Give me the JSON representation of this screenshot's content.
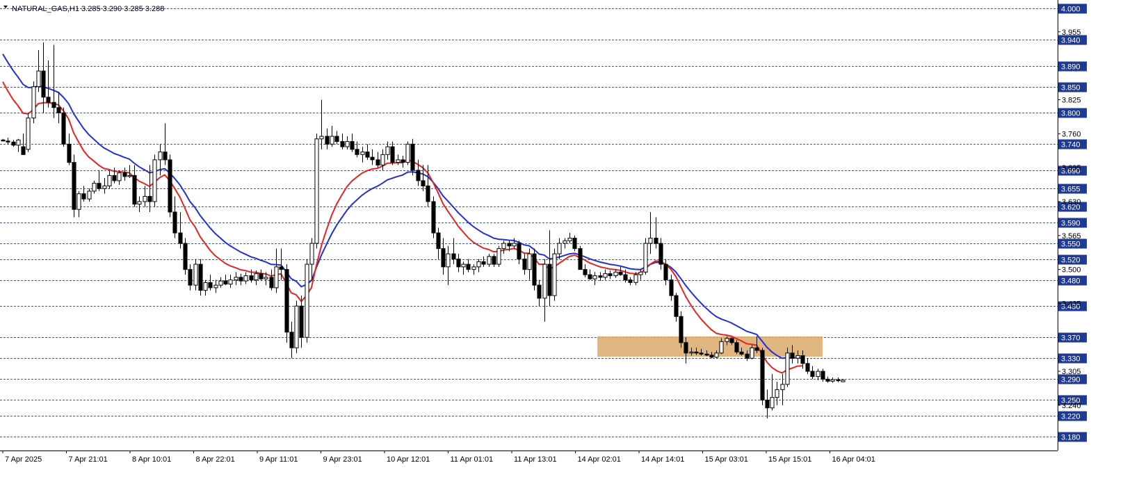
{
  "header": {
    "menu_icon": "triangle-down-icon",
    "symbol_line": "NATURAL_GAS,H1  3.285 3.290 3.285 3.288"
  },
  "colors": {
    "background": "#ffffff",
    "axis": "#000000",
    "bull_candle": "#ffffff",
    "bear_candle": "#000000",
    "level_line": "#1f3a93",
    "level_box": "#1f3a93",
    "ma_fast": "#e5231f",
    "ma_slow": "#1f2fdc",
    "zone_fill": "#d9a86a"
  },
  "chart_data": {
    "type": "candlestick",
    "symbol": "NATURAL_GAS",
    "timeframe": "H1",
    "last_ohlc": {
      "open": 3.285,
      "high": 3.29,
      "low": 3.285,
      "close": 3.288
    },
    "ylim": [
      3.16,
      4.0
    ],
    "price_scale_ticks": [
      "3.955",
      "3.825",
      "3.760",
      "3.695",
      "3.630",
      "3.565",
      "3.500",
      "3.435",
      "3.305",
      "3.240"
    ],
    "horizontal_levels": [
      "4.000",
      "3.940",
      "3.890",
      "3.850",
      "3.800",
      "3.740",
      "3.690",
      "3.655",
      "3.620",
      "3.590",
      "3.550",
      "3.520",
      "3.480",
      "3.430",
      "3.370",
      "3.330",
      "3.290",
      "3.250",
      "3.220",
      "3.180"
    ],
    "time_labels": [
      "7 Apr 2025",
      "7 Apr 21:01",
      "8 Apr 10:01",
      "8 Apr 22:01",
      "9 Apr 11:01",
      "9 Apr 23:01",
      "10 Apr 12:01",
      "11 Apr 01:01",
      "11 Apr 13:01",
      "14 Apr 02:01",
      "14 Apr 14:01",
      "15 Apr 03:01",
      "15 Apr 15:01",
      "16 Apr 04:01"
    ],
    "zone": {
      "price_high": 3.372,
      "price_low": 3.333,
      "start_index": 118,
      "end_index": 156
    },
    "ma_fast_label": "",
    "ma_slow_label": "",
    "candles": [
      [
        3.748,
        3.75,
        3.745,
        3.746
      ],
      [
        3.746,
        3.752,
        3.74,
        3.744
      ],
      [
        3.744,
        3.748,
        3.735,
        3.738
      ],
      [
        3.738,
        3.75,
        3.725,
        3.748
      ],
      [
        3.735,
        3.76,
        3.72,
        3.72
      ],
      [
        3.73,
        3.8,
        3.725,
        3.79
      ],
      [
        3.79,
        3.86,
        3.78,
        3.85
      ],
      [
        3.85,
        3.92,
        3.84,
        3.88
      ],
      [
        3.88,
        3.935,
        3.8,
        3.83
      ],
      [
        3.83,
        3.9,
        3.81,
        3.82
      ],
      [
        3.82,
        3.93,
        3.79,
        3.81
      ],
      [
        3.81,
        3.84,
        3.78,
        3.8
      ],
      [
        3.8,
        3.81,
        3.735,
        3.74
      ],
      [
        3.74,
        3.76,
        3.7,
        3.705
      ],
      [
        3.705,
        3.72,
        3.6,
        3.615
      ],
      [
        3.615,
        3.65,
        3.6,
        3.645
      ],
      [
        3.645,
        3.66,
        3.63,
        3.635
      ],
      [
        3.635,
        3.655,
        3.63,
        3.65
      ],
      [
        3.65,
        3.67,
        3.645,
        3.665
      ],
      [
        3.665,
        3.69,
        3.65,
        3.655
      ],
      [
        3.655,
        3.675,
        3.645,
        3.66
      ],
      [
        3.66,
        3.69,
        3.655,
        3.68
      ],
      [
        3.68,
        3.695,
        3.665,
        3.67
      ],
      [
        3.67,
        3.69,
        3.662,
        3.685
      ],
      [
        3.685,
        3.695,
        3.67,
        3.678
      ],
      [
        3.678,
        3.7,
        3.675,
        3.68
      ],
      [
        3.68,
        3.7,
        3.62,
        3.625
      ],
      [
        3.625,
        3.64,
        3.61,
        3.63
      ],
      [
        3.63,
        3.66,
        3.62,
        3.64
      ],
      [
        3.64,
        3.7,
        3.61,
        3.63
      ],
      [
        3.63,
        3.72,
        3.62,
        3.71
      ],
      [
        3.71,
        3.74,
        3.68,
        3.725
      ],
      [
        3.725,
        3.78,
        3.7,
        3.71
      ],
      [
        3.71,
        3.72,
        3.6,
        3.61
      ],
      [
        3.61,
        3.64,
        3.56,
        3.57
      ],
      [
        3.57,
        3.61,
        3.54,
        3.55
      ],
      [
        3.55,
        3.56,
        3.49,
        3.5
      ],
      [
        3.5,
        3.51,
        3.46,
        3.47
      ],
      [
        3.47,
        3.52,
        3.46,
        3.51
      ],
      [
        3.51,
        3.52,
        3.45,
        3.46
      ],
      [
        3.46,
        3.48,
        3.45,
        3.475
      ],
      [
        3.475,
        3.49,
        3.46,
        3.465
      ],
      [
        3.465,
        3.48,
        3.455,
        3.47
      ],
      [
        3.47,
        3.485,
        3.465,
        3.478
      ],
      [
        3.478,
        3.49,
        3.47,
        3.472
      ],
      [
        3.472,
        3.49,
        3.465,
        3.48
      ],
      [
        3.48,
        3.495,
        3.47,
        3.485
      ],
      [
        3.485,
        3.492,
        3.47,
        3.478
      ],
      [
        3.478,
        3.495,
        3.472,
        3.488
      ],
      [
        3.488,
        3.5,
        3.475,
        3.48
      ],
      [
        3.48,
        3.498,
        3.47,
        3.492
      ],
      [
        3.492,
        3.5,
        3.478,
        3.482
      ],
      [
        3.482,
        3.495,
        3.47,
        3.485
      ],
      [
        3.485,
        3.5,
        3.46,
        3.465
      ],
      [
        3.465,
        3.54,
        3.455,
        3.505
      ],
      [
        3.505,
        3.54,
        3.48,
        3.5
      ],
      [
        3.5,
        3.51,
        3.36,
        3.38
      ],
      [
        3.38,
        3.4,
        3.33,
        3.35
      ],
      [
        3.35,
        3.44,
        3.34,
        3.43
      ],
      [
        3.43,
        3.45,
        3.35,
        3.37
      ],
      [
        3.37,
        3.52,
        3.36,
        3.51
      ],
      [
        3.51,
        3.56,
        3.48,
        3.55
      ],
      [
        3.55,
        3.76,
        3.54,
        3.75
      ],
      [
        3.75,
        3.825,
        3.73,
        3.755
      ],
      [
        3.755,
        3.77,
        3.73,
        3.74
      ],
      [
        3.74,
        3.775,
        3.735,
        3.755
      ],
      [
        3.755,
        3.765,
        3.74,
        3.745
      ],
      [
        3.745,
        3.76,
        3.73,
        3.735
      ],
      [
        3.735,
        3.755,
        3.73,
        3.745
      ],
      [
        3.745,
        3.76,
        3.725,
        3.73
      ],
      [
        3.73,
        3.745,
        3.715,
        3.72
      ],
      [
        3.72,
        3.735,
        3.705,
        3.725
      ],
      [
        3.725,
        3.74,
        3.71,
        3.715
      ],
      [
        3.715,
        3.73,
        3.7,
        3.71
      ],
      [
        3.71,
        3.725,
        3.695,
        3.7
      ],
      [
        3.7,
        3.73,
        3.69,
        3.72
      ],
      [
        3.72,
        3.745,
        3.71,
        3.735
      ],
      [
        3.735,
        3.745,
        3.7,
        3.705
      ],
      [
        3.705,
        3.72,
        3.7,
        3.71
      ],
      [
        3.71,
        3.718,
        3.695,
        3.705
      ],
      [
        3.705,
        3.745,
        3.7,
        3.74
      ],
      [
        3.74,
        3.75,
        3.68,
        3.69
      ],
      [
        3.69,
        3.71,
        3.66,
        3.67
      ],
      [
        3.67,
        3.7,
        3.65,
        3.66
      ],
      [
        3.66,
        3.7,
        3.62,
        3.63
      ],
      [
        3.63,
        3.64,
        3.56,
        3.57
      ],
      [
        3.57,
        3.58,
        3.52,
        3.54
      ],
      [
        3.54,
        3.56,
        3.49,
        3.505
      ],
      [
        3.505,
        3.545,
        3.47,
        3.53
      ],
      [
        3.53,
        3.56,
        3.51,
        3.52
      ],
      [
        3.52,
        3.53,
        3.495,
        3.505
      ],
      [
        3.505,
        3.515,
        3.49,
        3.51
      ],
      [
        3.51,
        3.52,
        3.495,
        3.5
      ],
      [
        3.5,
        3.51,
        3.49,
        3.505
      ],
      [
        3.505,
        3.52,
        3.495,
        3.515
      ],
      [
        3.515,
        3.525,
        3.505,
        3.51
      ],
      [
        3.51,
        3.53,
        3.505,
        3.525
      ],
      [
        3.525,
        3.53,
        3.505,
        3.51
      ],
      [
        3.51,
        3.545,
        3.505,
        3.54
      ],
      [
        3.54,
        3.555,
        3.53,
        3.55
      ],
      [
        3.55,
        3.555,
        3.535,
        3.545
      ],
      [
        3.545,
        3.56,
        3.54,
        3.55
      ],
      [
        3.55,
        3.555,
        3.51,
        3.52
      ],
      [
        3.52,
        3.53,
        3.49,
        3.5
      ],
      [
        3.5,
        3.54,
        3.48,
        3.53
      ],
      [
        3.53,
        3.54,
        3.46,
        3.47
      ],
      [
        3.47,
        3.48,
        3.43,
        3.445
      ],
      [
        3.445,
        3.52,
        3.4,
        3.51
      ],
      [
        3.51,
        3.575,
        3.43,
        3.45
      ],
      [
        3.45,
        3.54,
        3.44,
        3.53
      ],
      [
        3.53,
        3.56,
        3.52,
        3.55
      ],
      [
        3.55,
        3.56,
        3.54,
        3.555
      ],
      [
        3.555,
        3.57,
        3.55,
        3.56
      ],
      [
        3.56,
        3.565,
        3.535,
        3.54
      ],
      [
        3.54,
        3.545,
        3.51,
        3.5
      ],
      [
        3.5,
        3.51,
        3.485,
        3.49
      ],
      [
        3.49,
        3.5,
        3.48,
        3.482
      ],
      [
        3.482,
        3.495,
        3.47,
        3.488
      ],
      [
        3.488,
        3.495,
        3.478,
        3.485
      ],
      [
        3.485,
        3.5,
        3.48,
        3.492
      ],
      [
        3.492,
        3.498,
        3.482,
        3.488
      ],
      [
        3.488,
        3.5,
        3.484,
        3.495
      ],
      [
        3.495,
        3.505,
        3.488,
        3.49
      ],
      [
        3.49,
        3.5,
        3.475,
        3.48
      ],
      [
        3.48,
        3.485,
        3.47,
        3.475
      ],
      [
        3.475,
        3.495,
        3.47,
        3.49
      ],
      [
        3.49,
        3.5,
        3.48,
        3.495
      ],
      [
        3.495,
        3.56,
        3.49,
        3.55
      ],
      [
        3.55,
        3.61,
        3.53,
        3.56
      ],
      [
        3.56,
        3.6,
        3.54,
        3.55
      ],
      [
        3.55,
        3.56,
        3.5,
        3.51
      ],
      [
        3.51,
        3.52,
        3.47,
        3.48
      ],
      [
        3.48,
        3.49,
        3.44,
        3.45
      ],
      [
        3.45,
        3.455,
        3.4,
        3.41
      ],
      [
        3.41,
        3.42,
        3.35,
        3.36
      ],
      [
        3.36,
        3.37,
        3.32,
        3.34
      ],
      [
        3.34,
        3.35,
        3.335,
        3.342
      ],
      [
        3.342,
        3.35,
        3.336,
        3.34
      ],
      [
        3.34,
        3.348,
        3.335,
        3.338
      ],
      [
        3.338,
        3.345,
        3.334,
        3.336
      ],
      [
        3.336,
        3.342,
        3.33,
        3.332
      ],
      [
        3.332,
        3.345,
        3.33,
        3.34
      ],
      [
        3.34,
        3.368,
        3.338,
        3.362
      ],
      [
        3.362,
        3.372,
        3.355,
        3.368
      ],
      [
        3.368,
        3.37,
        3.355,
        3.36
      ],
      [
        3.36,
        3.365,
        3.338,
        3.342
      ],
      [
        3.342,
        3.35,
        3.335,
        3.338
      ],
      [
        3.338,
        3.345,
        3.325,
        3.33
      ],
      [
        3.33,
        3.355,
        3.328,
        3.35
      ],
      [
        3.35,
        3.372,
        3.34,
        3.345
      ],
      [
        3.345,
        3.35,
        3.24,
        3.25
      ],
      [
        3.25,
        3.27,
        3.215,
        3.235
      ],
      [
        3.235,
        3.3,
        3.23,
        3.255
      ],
      [
        3.255,
        3.285,
        3.24,
        3.27
      ],
      [
        3.27,
        3.3,
        3.24,
        3.28
      ],
      [
        3.28,
        3.35,
        3.275,
        3.34
      ],
      [
        3.34,
        3.355,
        3.32,
        3.33
      ],
      [
        3.33,
        3.345,
        3.32,
        3.335
      ],
      [
        3.335,
        3.345,
        3.31,
        3.32
      ],
      [
        3.32,
        3.33,
        3.3,
        3.305
      ],
      [
        3.305,
        3.315,
        3.29,
        3.295
      ],
      [
        3.295,
        3.31,
        3.288,
        3.305
      ],
      [
        3.305,
        3.31,
        3.285,
        3.29
      ],
      [
        3.29,
        3.295,
        3.283,
        3.286
      ],
      [
        3.286,
        3.293,
        3.283,
        3.289
      ],
      [
        3.289,
        3.293,
        3.284,
        3.287
      ],
      [
        3.285,
        3.29,
        3.285,
        3.288
      ]
    ]
  }
}
